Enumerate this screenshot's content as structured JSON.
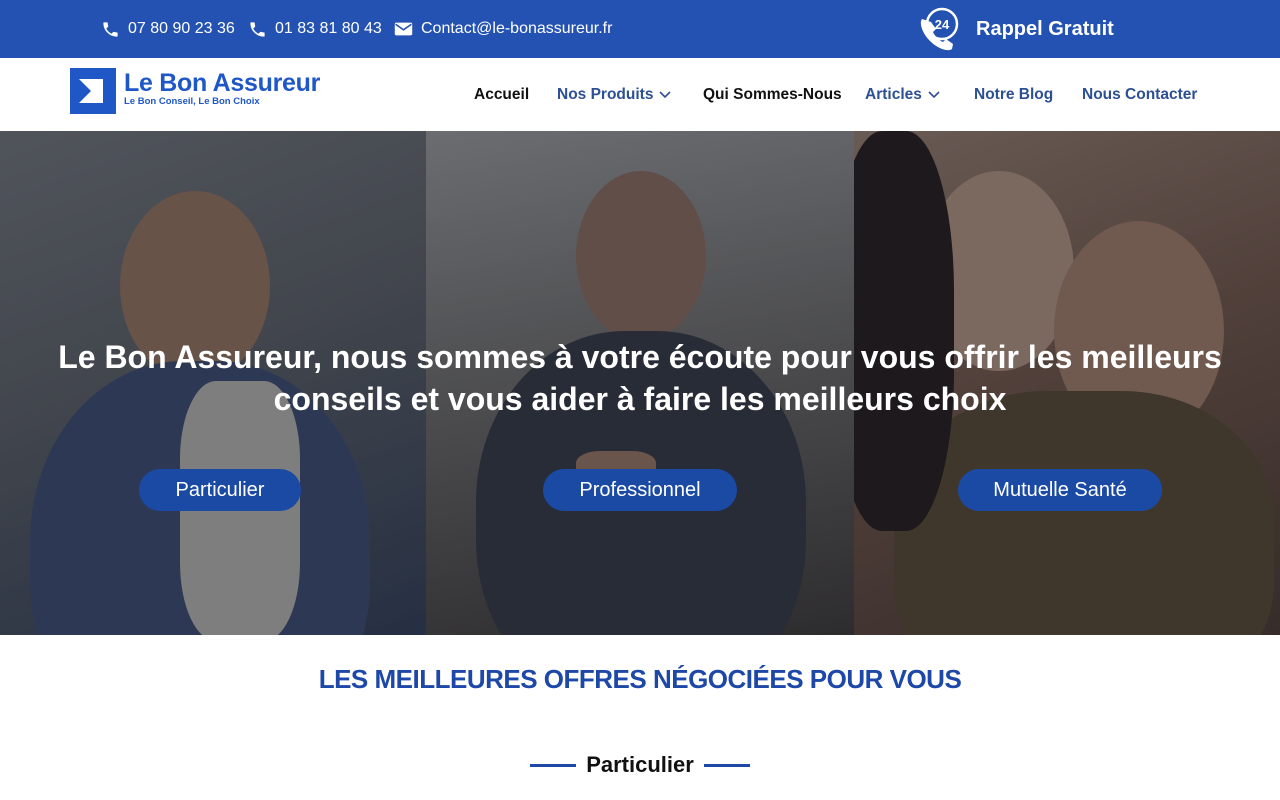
{
  "topbar": {
    "phone_1": "07 80 90 23 36",
    "phone_2": "01 83 81 80 43",
    "email": "Contact@le-bonassureur.fr",
    "callback_badge": "24",
    "callback_label": "Rappel Gratuit",
    "icons": [
      "phone-icon",
      "phone-icon",
      "envelope-icon",
      "phone-24-icon"
    ]
  },
  "header": {
    "logo_title": "Le Bon Assureur",
    "logo_tagline": "Le Bon Conseil, Le Bon Choix",
    "nav": [
      {
        "label": "Accueil",
        "has_dropdown": false
      },
      {
        "label": "Nos Produits",
        "has_dropdown": true
      },
      {
        "label": "Qui Sommes-Nous",
        "has_dropdown": false
      },
      {
        "label": "Articles",
        "has_dropdown": true
      },
      {
        "label": "Notre Blog",
        "has_dropdown": false
      },
      {
        "label": "Nous Contacter",
        "has_dropdown": false
      }
    ]
  },
  "hero": {
    "heading": "Le Bon Assureur, nous sommes à votre écoute pour vous offrir les meilleurs conseils et vous aider à faire les meilleurs choix",
    "buttons": [
      {
        "label": "Particulier"
      },
      {
        "label": "Professionnel"
      },
      {
        "label": "Mutuelle Santé"
      }
    ]
  },
  "offers": {
    "title": "LES MEILLEURES OFFRES NÉGOCIÉES POUR VOUS",
    "subtitle": "Particulier"
  },
  "colors": {
    "topbar_bg": "#2452b3",
    "brand_blue": "#1f57c7",
    "nav_blue": "#2d4f93",
    "button_blue": "#1b4aa5",
    "section_title": "#1d48a8"
  }
}
